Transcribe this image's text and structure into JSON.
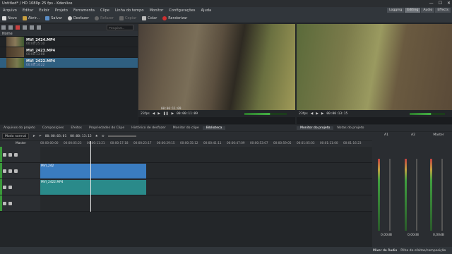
{
  "window": {
    "title": "Untitled* / HD 1080p 25 fps - Kdenlive",
    "wc": [
      "—",
      "☐",
      "✕"
    ]
  },
  "menu": [
    "Arquivo",
    "Editar",
    "Exibir",
    "Projeto",
    "Ferramenta",
    "Clipe",
    "Linha do tempo",
    "Monitor",
    "Configurações",
    "Ajuda"
  ],
  "layouts": [
    "Logging",
    "Editing",
    "Audio",
    "Effects"
  ],
  "toolbar": {
    "new": "Novo",
    "open": "Abrir...",
    "save": "Salvar",
    "undo": "Desfazer",
    "redo": "Refazer",
    "copy": "Copiar",
    "paste": "Colar",
    "render": "Renderizar"
  },
  "bin": {
    "search_placeholder": "Pesquisar...",
    "header": "Nome",
    "clips": [
      {
        "name": "MVI_2424.MP4",
        "dur": "00:00:25:10"
      },
      {
        "name": "MVI_2423.MP4",
        "dur": "00:00:13:08"
      },
      {
        "name": "MVI_2422.MP4",
        "dur": "00:00:14:22"
      }
    ]
  },
  "left_tabs": [
    "Arquivos do projeto",
    "Composições",
    "Efeitos",
    "Propriedades do Clipe",
    "Histórico de desfazer",
    "Monitor do clipe",
    "Biblioteca"
  ],
  "clip_monitor": {
    "timecode": "00:00:11:09",
    "fps": "23fps",
    "label": "Monitor do clipe"
  },
  "project_monitor": {
    "timecode": "00:00:13:15",
    "fps": "23fps",
    "timecode_left": "00:00:00:01",
    "label": "Monitor do projeto",
    "label2": "Notas do projeto"
  },
  "timeline": {
    "mode": "Modo normal",
    "position": "00:00:03:01",
    "duration": "00:00:13:15",
    "ruler": [
      "00:00:00:00",
      "00:00:05:23",
      "00:00:11:21",
      "00:00:17:18",
      "00:00:23:17",
      "00:00:29:15",
      "00:00:35:12",
      "00:00:41:11",
      "00:00:47:09",
      "00:00:53:07",
      "00:00:59:05",
      "00:01:05:03",
      "00:01:11:00",
      "00:01:16:23",
      "00:01:22:22"
    ],
    "master": "Master",
    "video_clip": "MVI_242",
    "audio_clip": "MVI_2422.MP4",
    "ruler_label": "Master"
  },
  "mixer": {
    "channels": [
      {
        "name": "A1",
        "db": "0,00dB"
      },
      {
        "name": "A2",
        "db": "0,00dB"
      },
      {
        "name": "Master",
        "db": "0,00dB"
      }
    ]
  },
  "bottom_tabs": [
    "Mixer de Áudio",
    "Pilha de efeitos/composição"
  ]
}
